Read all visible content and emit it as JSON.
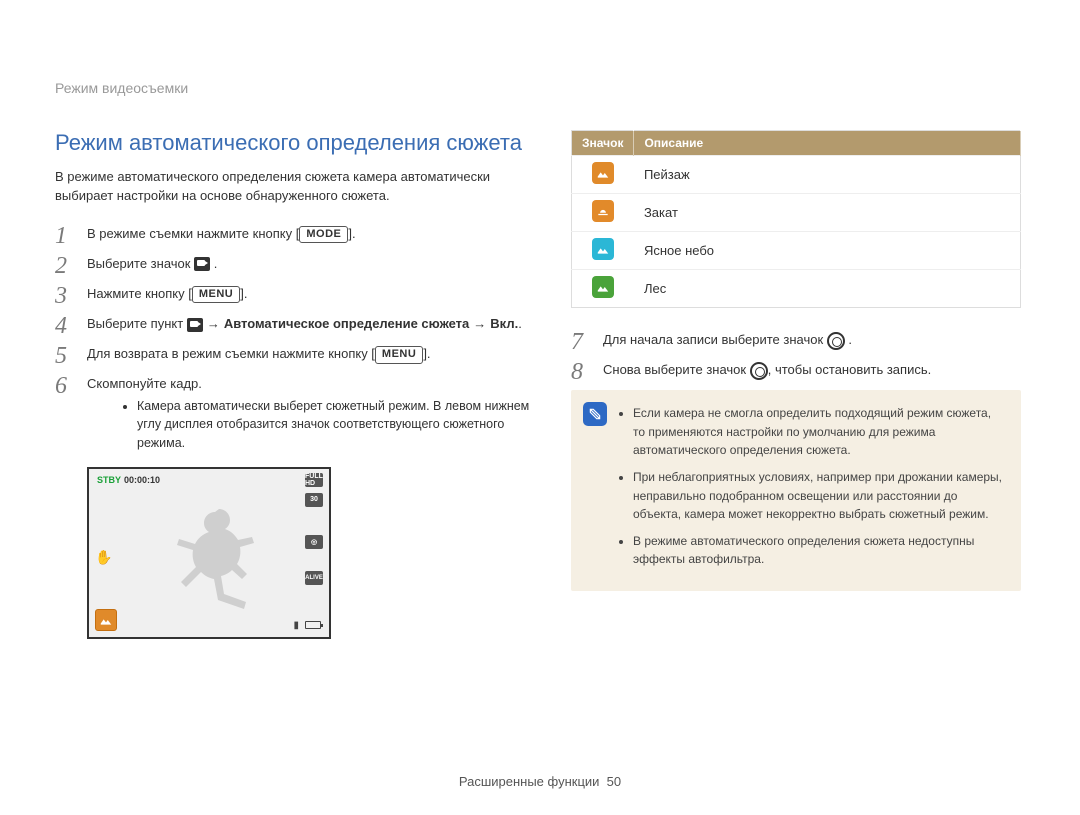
{
  "breadcrumb": "Режим видеосъемки",
  "title": "Режим автоматического определения сюжета",
  "intro": "В режиме автоматического определения сюжета камера автоматически выбирает настройки на основе обнаруженного сюжета.",
  "buttons": {
    "mode": "MODE",
    "menu": "MENU"
  },
  "steps": {
    "s1_a": "В режиме съемки нажмите кнопку [",
    "s1_b": "].",
    "s2_a": "Выберите значок ",
    "s2_b": " .",
    "s3_a": "Нажмите кнопку [",
    "s3_b": "].",
    "s4_a": "Выберите пункт ",
    "s4_bold": "Автоматическое определение сюжета",
    "s4_arrow2": "Вкл.",
    "s4_tail": ".",
    "s5_a": "Для возврата в режим съемки нажмите кнопку [",
    "s5_b": "].",
    "s6": "Скомпонуйте кадр."
  },
  "sublist": [
    "Камера автоматически выберет сюжетный режим. В левом нижнем углу дисплея отобразится значок соответствующего сюжетного режима."
  ],
  "preview": {
    "status": "STBY",
    "time": "00:00:10",
    "resolution": "FULL HD",
    "fps": "30",
    "alive": "ALIVE"
  },
  "table": {
    "head_icon": "Значок",
    "head_desc": "Описание",
    "rows": [
      {
        "key": "landscape",
        "label": "Пейзаж"
      },
      {
        "key": "sunset",
        "label": "Закат"
      },
      {
        "key": "sky",
        "label": "Ясное небо"
      },
      {
        "key": "forest",
        "label": "Лес"
      }
    ]
  },
  "steps_right": {
    "s7_a": "Для начала записи выберите значок ",
    "s7_b": " .",
    "s8_a": "Снова выберите значок ",
    "s8_b": ", чтобы остановить запись."
  },
  "notes": [
    "Если камера не смогла определить подходящий режим сюжета, то применяются настройки по умолчанию для режима автоматического определения сюжета.",
    "При неблагоприятных условиях, например при дрожании камеры, неправильно подобранном освещении или расстоянии до объекта, камера может некорректно выбрать сюжетный режим.",
    "В режиме автоматического определения сюжета недоступны эффекты автофильтра."
  ],
  "footer": {
    "section": "Расширенные функции",
    "page": "50"
  }
}
